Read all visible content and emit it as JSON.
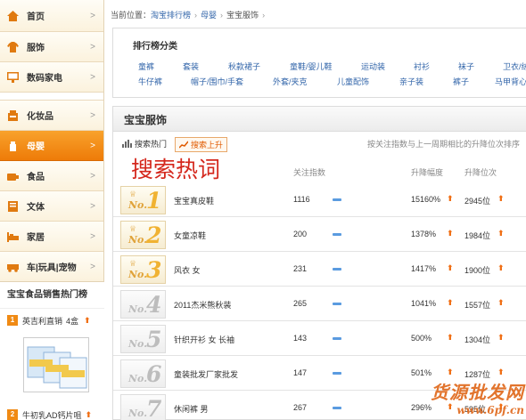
{
  "sidebar": {
    "items": [
      {
        "label": "首页",
        "icon": "home-icon"
      },
      {
        "label": "服饰",
        "icon": "clothing-icon"
      },
      {
        "label": "数码家电",
        "icon": "monitor-icon"
      },
      {
        "label": "化妆品",
        "icon": "cosmetics-icon"
      },
      {
        "label": "母婴",
        "icon": "baby-bottle-icon"
      },
      {
        "label": "食品",
        "icon": "food-icon"
      },
      {
        "label": "文体",
        "icon": "book-icon"
      },
      {
        "label": "家居",
        "icon": "bed-icon"
      },
      {
        "label": "车|玩具|宠物",
        "icon": "car-icon"
      }
    ],
    "arrow": ">",
    "hot_title": "宝宝食品销售热门榜",
    "hot_list": [
      {
        "rank": "1",
        "name": "英吉利直销",
        "count": "4盒",
        "trend": "up"
      },
      {
        "rank": "2",
        "name": "牛初乳AD钙片咀",
        "count": "",
        "trend": "up"
      }
    ]
  },
  "breadcrumb": {
    "prefix": "当前位置：",
    "items": [
      "淘宝排行榜",
      "母婴",
      "宝宝服饰"
    ],
    "separator": "›"
  },
  "categories": {
    "title": "排行榜分类",
    "row1": [
      "童裤",
      "套装",
      "秋款裙子",
      "童鞋/婴儿鞋",
      "运动装",
      "衬衫",
      "袜子",
      "卫衣/绒衫"
    ],
    "row2": [
      "牛仔裤",
      "帽子/围巾/手套",
      "外套/夹克",
      "儿童配饰",
      "亲子装",
      "裤子",
      "马甲背心"
    ]
  },
  "ranking": {
    "title": "宝宝服饰",
    "tab_hot": "搜索热门",
    "tab_rise": "搜索上升",
    "note": "按关注指数与上一周期相比的升降位次排序",
    "big_title": "搜索热词",
    "col_attention": "关注指数",
    "col_rise": "升降幅度",
    "col_position": "升降位次",
    "badge_prefix": "No.",
    "rows": [
      {
        "rank": "1",
        "name": "宝宝真皮鞋",
        "attention": "1116",
        "rise": "15160%",
        "position": "2945位",
        "gold": true
      },
      {
        "rank": "2",
        "name": "女童凉鞋",
        "attention": "200",
        "rise": "1378%",
        "position": "1984位",
        "gold": true
      },
      {
        "rank": "3",
        "name": "风衣 女",
        "attention": "231",
        "rise": "1417%",
        "position": "1900位",
        "gold": true
      },
      {
        "rank": "4",
        "name": "2011杰米熊秋装",
        "attention": "265",
        "rise": "1041%",
        "position": "1557位",
        "gold": false
      },
      {
        "rank": "5",
        "name": "针织开衫 女 长袖",
        "attention": "143",
        "rise": "500%",
        "position": "1304位",
        "gold": false
      },
      {
        "rank": "6",
        "name": "童装批发厂家批发",
        "attention": "147",
        "rise": "501%",
        "position": "1287位",
        "gold": false
      },
      {
        "rank": "7",
        "name": "休闲裤 男",
        "attention": "267",
        "rise": "296%",
        "position": "595位",
        "gold": false
      }
    ]
  },
  "watermark": {
    "line1": "货源批发网",
    "line2": "www.6pf.cn"
  },
  "colors": {
    "accent": "#ee7b08",
    "link": "#3366aa",
    "title_red": "#d4271c",
    "up_arrow": "#f06d12"
  }
}
